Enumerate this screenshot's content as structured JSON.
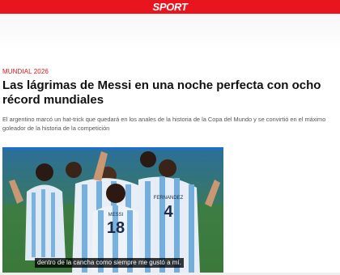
{
  "header": {
    "logo_text": "SPORT",
    "brand_color": "#e8141e"
  },
  "article": {
    "category": "MUNDIAL 2026",
    "headline": "Las lágrimas de Messi en una noche perfecta con ocho récord mundiales",
    "standfirst": "El argentino marcó un hat-trick que quedará en los anales de la historia de la Copa del Mundo y se convirtió en el máximo goleador de la historia de la competición"
  },
  "video": {
    "caption": "dentro de la cancha como siempre me gustó a mí.",
    "jersey_names": [
      "MESSI",
      "FERNANDEZ"
    ],
    "jersey_numbers": [
      "18",
      "4"
    ]
  }
}
